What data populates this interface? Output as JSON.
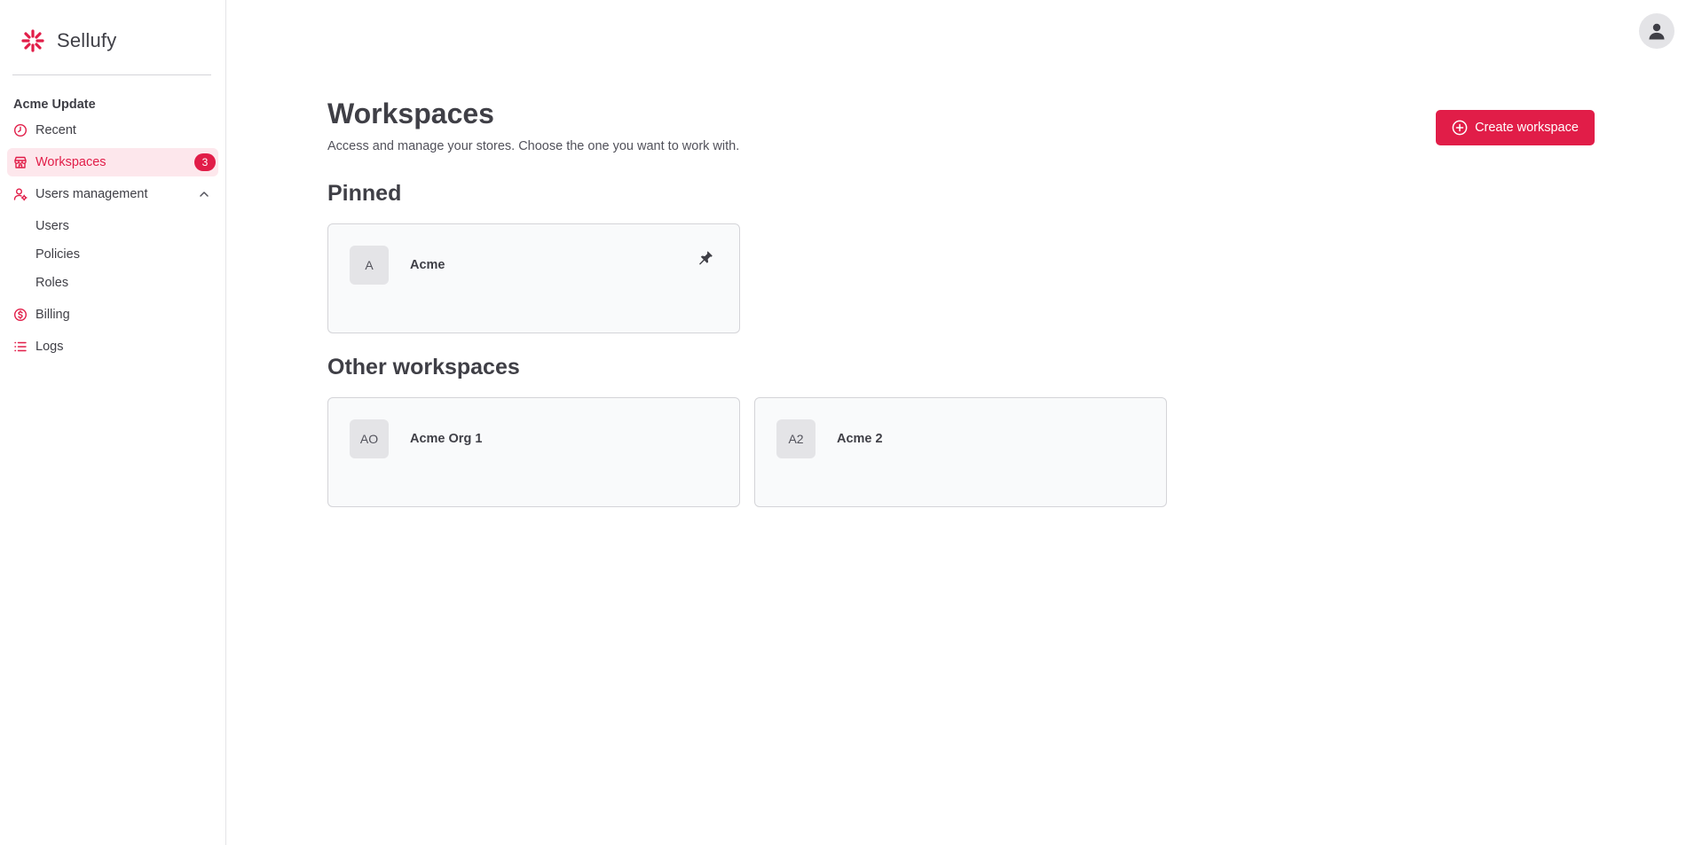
{
  "brand": {
    "name": "Sellufy",
    "logo_icon": "sellufy-logo-icon"
  },
  "sidebar": {
    "org_name": "Acme Update",
    "items": [
      {
        "label": "Recent",
        "icon": "clock-icon"
      },
      {
        "label": "Workspaces",
        "icon": "store-icon",
        "badge": "3",
        "active": true
      },
      {
        "label": "Users management",
        "icon": "user-cog-icon",
        "expanded": true,
        "subitems": [
          {
            "label": "Users"
          },
          {
            "label": "Policies"
          },
          {
            "label": "Roles"
          }
        ]
      },
      {
        "label": "Billing",
        "icon": "dollar-circle-icon"
      },
      {
        "label": "Logs",
        "icon": "list-icon"
      }
    ]
  },
  "header": {
    "avatar_icon": "user-icon"
  },
  "main": {
    "title": "Workspaces",
    "subtitle": "Access and manage your stores. Choose the one you want to work with.",
    "create_button_label": "Create workspace",
    "pinned_title": "Pinned",
    "pinned": [
      {
        "initials": "A",
        "name": "Acme"
      }
    ],
    "other_title": "Other workspaces",
    "others": [
      {
        "initials": "AO",
        "name": "Acme Org 1"
      },
      {
        "initials": "A2",
        "name": "Acme 2"
      }
    ]
  },
  "colors": {
    "accent": "#e11d48",
    "accent_light": "#fde7ec",
    "text": "#3f3f46",
    "card_bg": "#f9fafb"
  }
}
